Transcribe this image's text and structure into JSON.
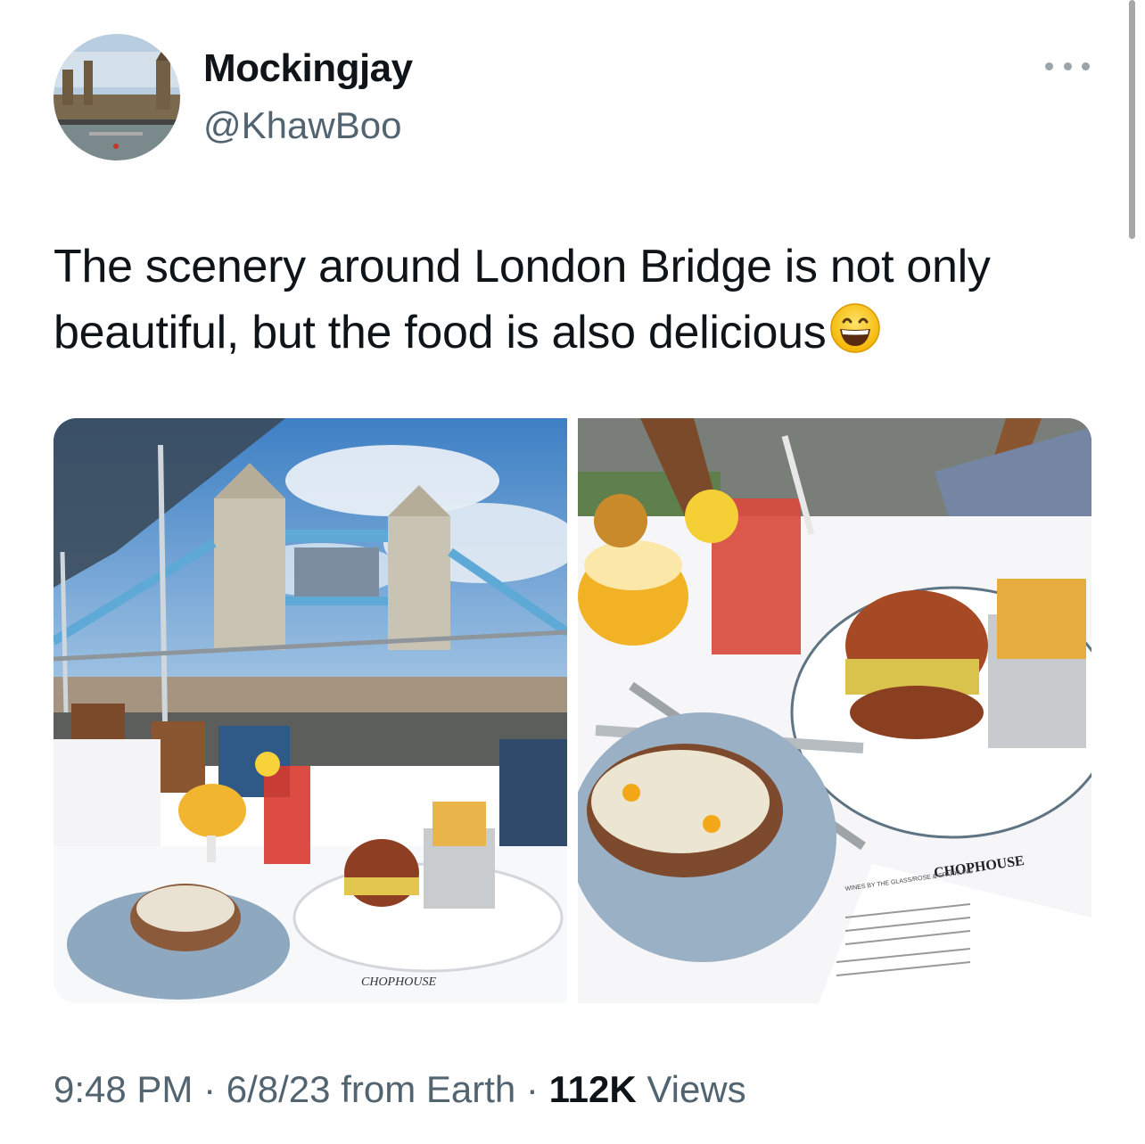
{
  "author": {
    "name": "Mockingjay",
    "handle": "@KhawBoo",
    "avatar_icon": "avatar-westminster-photo"
  },
  "more_icon": "more-options-icon",
  "tweet": {
    "text": "The scenery around London Bridge is not only beautiful, but the food is also delicious",
    "emoji": "grinning-face-with-smiling-eyes"
  },
  "media": [
    {
      "id": "photo-1",
      "alt_kind": "restaurant-terrace-tower-bridge-photo",
      "menu_brand": "CHOPHOUSE"
    },
    {
      "id": "photo-2",
      "alt_kind": "table-food-closeup-photo",
      "menu_brand": "CHOPHOUSE",
      "menu_heading": "WINES BY THE GLASS/ROSE & SPARKLING"
    }
  ],
  "metadata": {
    "time": "9:48 PM",
    "sep1": " · ",
    "date": "6/8/23",
    "from": " from Earth",
    "sep2": " · ",
    "views_count": "112K",
    "views_label": " Views"
  },
  "colors": {
    "text": "#0f1419",
    "secondary": "#536471",
    "dots": "#9aa4ad"
  }
}
